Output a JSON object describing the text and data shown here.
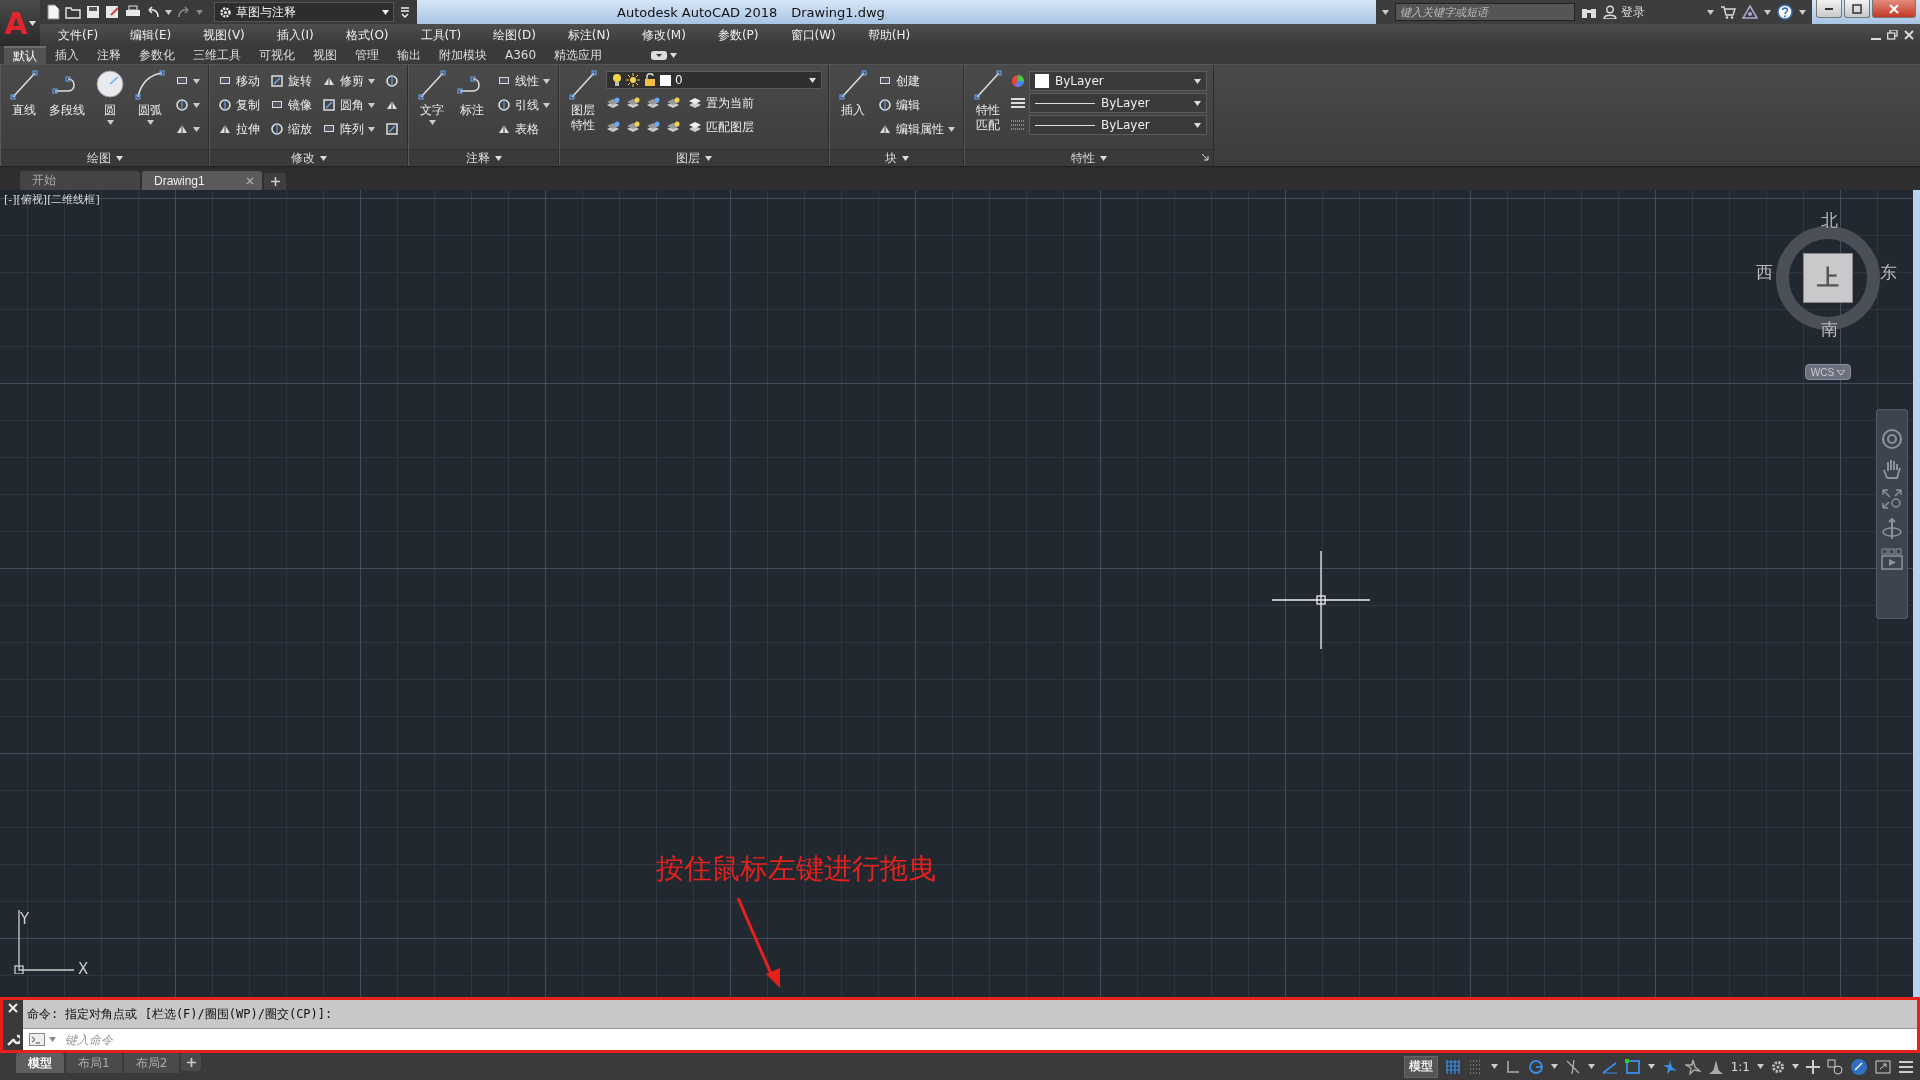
{
  "title_bar": {
    "app_menu": "A",
    "workspace": "草图与注释",
    "title": "Autodesk AutoCAD 2018",
    "filename": "Drawing1.dwg",
    "search": {
      "placeholder": "键入关键字或短语"
    },
    "sign_in": "登录"
  },
  "menu_bar": [
    "文件(F)",
    "编辑(E)",
    "视图(V)",
    "插入(I)",
    "格式(O)",
    "工具(T)",
    "绘图(D)",
    "标注(N)",
    "修改(M)",
    "参数(P)",
    "窗口(W)",
    "帮助(H)"
  ],
  "ribbon_tabs": [
    {
      "label": "默认",
      "selected": true
    },
    {
      "label": "插入",
      "selected": false
    },
    {
      "label": "注释",
      "selected": false
    },
    {
      "label": "参数化",
      "selected": false
    },
    {
      "label": "三维工具",
      "selected": false
    },
    {
      "label": "可视化",
      "selected": false
    },
    {
      "label": "视图",
      "selected": false
    },
    {
      "label": "管理",
      "selected": false
    },
    {
      "label": "输出",
      "selected": false
    },
    {
      "label": "附加模块",
      "selected": false
    },
    {
      "label": "A360",
      "selected": false
    },
    {
      "label": "精选应用",
      "selected": false
    }
  ],
  "ribbon_panels": [
    {
      "title": "绘图",
      "launcher": false,
      "groups": [
        {
          "kind": "large",
          "label": "直线",
          "dropdown": false
        },
        {
          "kind": "large",
          "label": "多段线",
          "dropdown": false
        },
        {
          "kind": "large",
          "label": "圆",
          "dropdown": true
        },
        {
          "kind": "large",
          "label": "圆弧",
          "dropdown": true
        },
        {
          "kind": "small",
          "items": [
            {
              "dropdown": true
            },
            {
              "dropdown": true
            },
            {
              "dropdown": true
            }
          ]
        }
      ]
    },
    {
      "title": "修改",
      "launcher": false,
      "groups": [
        {
          "kind": "small",
          "items": [
            {
              "label": "移动",
              "dropdown": false
            },
            {
              "label": "复制",
              "dropdown": false
            },
            {
              "label": "拉伸",
              "dropdown": false
            }
          ]
        },
        {
          "kind": "small",
          "items": [
            {
              "label": "旋转",
              "dropdown": false
            },
            {
              "label": "镜像",
              "dropdown": false
            },
            {
              "label": "缩放",
              "dropdown": false
            }
          ]
        },
        {
          "kind": "small",
          "items": [
            {
              "label": "修剪",
              "dropdown": true
            },
            {
              "label": "圆角",
              "dropdown": true
            },
            {
              "label": "阵列",
              "dropdown": true
            }
          ]
        },
        {
          "kind": "small",
          "items": [
            {
              "dropdown": false
            },
            {
              "dropdown": false
            },
            {
              "dropdown": false
            }
          ]
        }
      ]
    },
    {
      "title": "注释",
      "launcher": false,
      "groups": [
        {
          "kind": "large",
          "label": "文字",
          "dropdown": true
        },
        {
          "kind": "large",
          "label": "标注",
          "dropdown": false
        },
        {
          "kind": "small",
          "items": [
            {
              "label": "线性",
              "dropdown": true
            },
            {
              "label": "引线",
              "dropdown": true
            },
            {
              "label": "表格",
              "dropdown": false
            }
          ]
        }
      ]
    },
    {
      "title": "图层",
      "launcher": false,
      "groups": [
        {
          "kind": "large",
          "label": "图层特性",
          "dropdown": false
        },
        {
          "kind": "layer",
          "value": "0",
          "rows": [
            {
              "label": "置为当前"
            },
            {
              "label": "匹配图层"
            }
          ]
        }
      ]
    },
    {
      "title": "块",
      "launcher": false,
      "groups": [
        {
          "kind": "large",
          "label": "插入",
          "dropdown": false
        },
        {
          "kind": "small",
          "items": [
            {
              "label": "创建",
              "dropdown": false
            },
            {
              "label": "编辑",
              "dropdown": false
            },
            {
              "label": "编辑属性",
              "dropdown": true
            }
          ]
        }
      ]
    },
    {
      "title": "特性",
      "launcher": true,
      "groups": [
        {
          "kind": "large",
          "label": "特性匹配",
          "dropdown": false
        },
        {
          "kind": "props",
          "combos": [
            {
              "kind": "color",
              "value": "ByLayer"
            },
            {
              "kind": "linetype",
              "value": "ByLayer"
            },
            {
              "kind": "lineweight",
              "value": "ByLayer"
            }
          ]
        }
      ]
    }
  ],
  "document_tabs": [
    {
      "label": "开始",
      "selected": false,
      "closable": false
    },
    {
      "label": "Drawing1",
      "selected": true,
      "closable": true
    }
  ],
  "viewport": {
    "label": "[-][俯视][二维线框]",
    "viewcube": {
      "north": "北",
      "south": "南",
      "east": "东",
      "west": "西",
      "face": "上",
      "coordinate_system": "WCS"
    },
    "ucs": {
      "x": "X",
      "y": "Y"
    }
  },
  "annotation": {
    "text": "按住鼠标左键进行拖曳"
  },
  "command_line": {
    "history": "命令: 指定对角点或 [栏选(F)/圈围(WP)/圈交(CP)]:",
    "placeholder": "键入命令"
  },
  "layout_tabs": [
    {
      "label": "模型",
      "selected": true
    },
    {
      "label": "布局1",
      "selected": false
    },
    {
      "label": "布局2",
      "selected": false
    }
  ],
  "status_bar": {
    "model": "模型",
    "scale": "1:1",
    "toggles": [
      {
        "kind": "grid",
        "on": true
      },
      {
        "kind": "snap",
        "on": false
      },
      {
        "kind": "ortho",
        "on": false
      },
      {
        "kind": "polar",
        "on": true
      },
      {
        "kind": "isometric",
        "on": false
      },
      {
        "kind": "tracking",
        "on": true
      },
      {
        "kind": "osnap",
        "on": true
      },
      {
        "kind": "annotation",
        "on": true
      },
      {
        "kind": "autoscale",
        "on": false
      },
      {
        "kind": "annoscale",
        "on": false
      }
    ]
  }
}
